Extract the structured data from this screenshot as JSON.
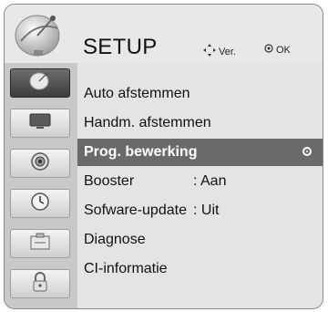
{
  "header": {
    "title": "SETUP",
    "hint_move_label": "Ver.",
    "hint_ok_label": "OK"
  },
  "sidebar": {
    "items": [
      {
        "icon": "satellite-dish-icon",
        "active": true
      },
      {
        "icon": "monitor-icon",
        "active": false
      },
      {
        "icon": "speaker-icon",
        "active": false
      },
      {
        "icon": "clock-icon",
        "active": false
      },
      {
        "icon": "options-box-icon",
        "active": false
      },
      {
        "icon": "lock-icon",
        "active": false
      }
    ]
  },
  "menu": {
    "items": [
      {
        "label": "Auto afstemmen",
        "value": ""
      },
      {
        "label": "Handm. afstemmen",
        "value": ""
      },
      {
        "label": "Prog. bewerking",
        "value": "",
        "selected": true
      },
      {
        "label": "Booster",
        "value": ": Aan"
      },
      {
        "label": "Sofware-update",
        "value": ": Uit"
      },
      {
        "label": "Diagnose",
        "value": ""
      },
      {
        "label": "CI-informatie",
        "value": ""
      }
    ]
  },
  "colors": {
    "selection_bg": "#6a6a6a",
    "sidebar_active": "#4a4a4a",
    "panel_bg": "#e4e4e4"
  }
}
